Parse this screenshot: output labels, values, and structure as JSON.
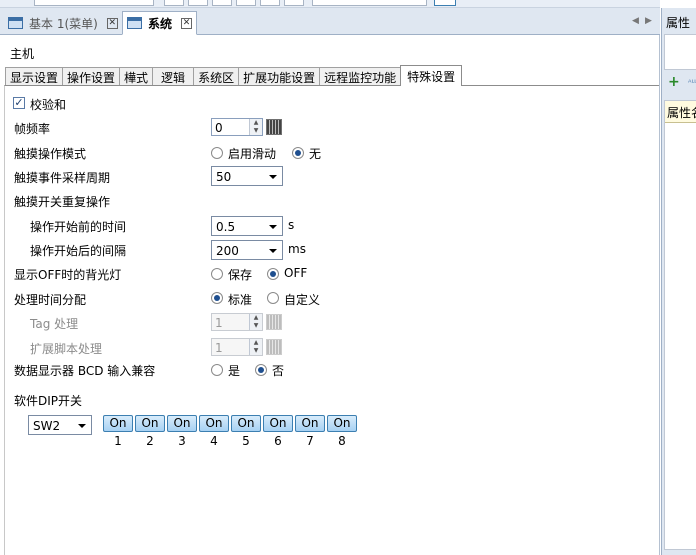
{
  "toolbar": {},
  "doc_tabs": [
    {
      "label": "基本 1(菜单)"
    },
    {
      "label": "系统"
    }
  ],
  "main": {
    "header": "主机",
    "tabs": [
      "显示设置",
      "操作设置",
      "樺式",
      "逻辑",
      "系统区",
      "扩展功能设置",
      "远程监控功能",
      "特殊设置"
    ],
    "active_tab": "特殊设置",
    "checksum": {
      "label": "校验和",
      "checked": true
    },
    "frame_rate": {
      "label": "帧频率",
      "value": "0"
    },
    "touch_mode": {
      "label": "触摸操作模式",
      "options": [
        "启用滑动",
        "无"
      ],
      "selected": "无"
    },
    "touch_sampling": {
      "label": "触摸事件采样周期",
      "value": "50"
    },
    "touch_repeat": {
      "label": "触摸开关重复操作"
    },
    "before_time": {
      "label": "操作开始前的时间",
      "value": "0.5",
      "unit": "s"
    },
    "after_interval": {
      "label": "操作开始后的间隔",
      "value": "200",
      "unit": "ms"
    },
    "backlight": {
      "label": "显示OFF时的背光灯",
      "options": [
        "保存",
        "OFF"
      ],
      "selected": "OFF"
    },
    "time_division": {
      "label": "处理时间分配",
      "options": [
        "标准",
        "自定义"
      ],
      "selected": "标准"
    },
    "tag_process": {
      "label": "Tag 处理",
      "value": "1"
    },
    "script_process": {
      "label": "扩展脚本处理",
      "value": "1"
    },
    "bcd": {
      "label": "数据显示器 BCD 输入兼容",
      "options": [
        "是",
        "否"
      ],
      "selected": "否"
    },
    "dip": {
      "label": "软件DIP开关",
      "selector": "SW2",
      "switches": [
        {
          "state": "On",
          "number": "1"
        },
        {
          "state": "On",
          "number": "2"
        },
        {
          "state": "On",
          "number": "3"
        },
        {
          "state": "On",
          "number": "4"
        },
        {
          "state": "On",
          "number": "5"
        },
        {
          "state": "On",
          "number": "6"
        },
        {
          "state": "On",
          "number": "7"
        },
        {
          "state": "On",
          "number": "8"
        }
      ]
    }
  },
  "right_panel": {
    "title": "属性",
    "prop_header": "属性名"
  }
}
